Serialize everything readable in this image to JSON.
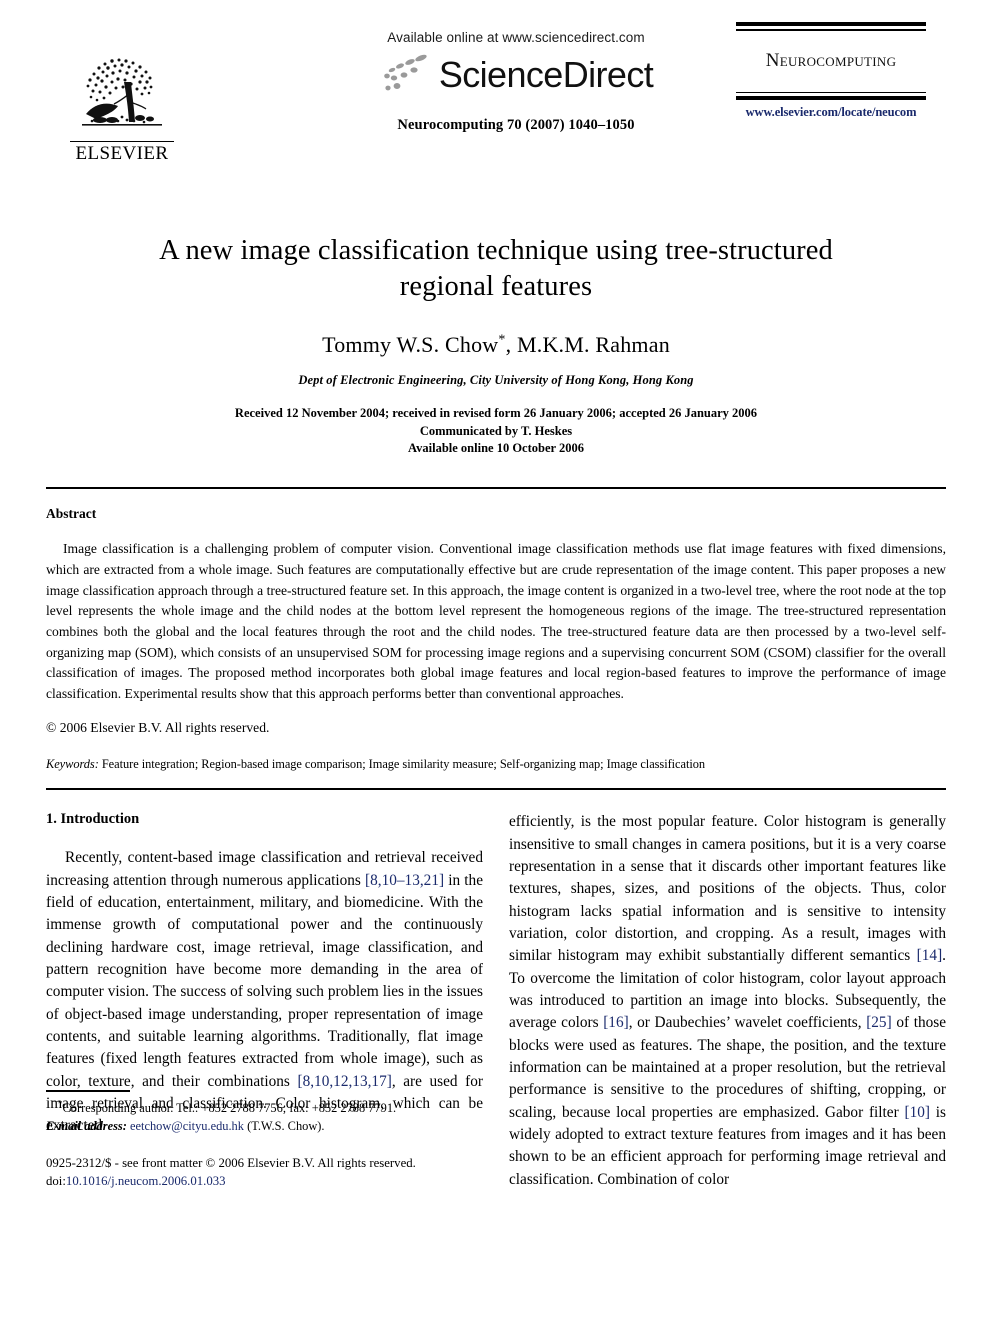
{
  "masthead": {
    "available_online": "Available online at www.sciencedirect.com",
    "sciencedirect_wordmark": "ScienceDirect",
    "journal_reference": "Neurocomputing 70 (2007) 1040–1050",
    "publisher_name": "ELSEVIER",
    "journal_brand": "Neurocomputing",
    "journal_url": "www.elsevier.com/locate/neucom"
  },
  "title_block": {
    "title": "A new image classification technique using tree-structured regional features",
    "authors_prefix": "Tommy W.S. Chow",
    "authors_marker": "*",
    "authors_suffix": ", M.K.M. Rahman",
    "affiliation": "Dept of Electronic Engineering, City University of Hong Kong, Hong Kong",
    "history_line1": "Received 12 November 2004; received in revised form 26 January 2006; accepted 26 January 2006",
    "history_line2": "Communicated by T. Heskes",
    "history_line3": "Available online 10 October 2006"
  },
  "abstract": {
    "heading": "Abstract",
    "body": "Image classification is a challenging problem of computer vision. Conventional image classification methods use flat image features with fixed dimensions, which are extracted from a whole image. Such features are computationally effective but are crude representation of the image content. This paper proposes a new image classification approach through a tree-structured feature set. In this approach, the image content is organized in a two-level tree, where the root node at the top level represents the whole image and the child nodes at the bottom level represent the homogeneous regions of the image. The tree-structured representation combines both the global and the local features through the root and the child nodes. The tree-structured feature data are then processed by a two-level self-organizing map (SOM), which consists of an unsupervised SOM for processing image regions and a supervising concurrent SOM (CSOM) classifier for the overall classification of images. The proposed method incorporates both global image features and local region-based features to improve the performance of image classification. Experimental results show that this approach performs better than conventional approaches.",
    "copyright": "© 2006 Elsevier B.V. All rights reserved.",
    "keywords_label": "Keywords:",
    "keywords_values": "Feature integration; Region-based image comparison; Image similarity measure; Self-organizing map; Image classification"
  },
  "introduction": {
    "heading": "1. Introduction",
    "left_paragraph_parts": [
      {
        "type": "text",
        "value": "Recently, content-based image classification and retrieval received increasing attention through numerous applications "
      },
      {
        "type": "cite",
        "value": "[8,10–13,21]"
      },
      {
        "type": "text",
        "value": " in the field of education, entertainment, military, and biomedicine. With the immense growth of computational power and the continuously declining hardware cost, image retrieval, image classification, and pattern recognition have become more demanding in the area of computer vision. The success of solving such problem lies in the issues of object-based image understanding, proper representation of image contents, and suitable learning algorithms. Traditionally, flat image features (fixed length features extracted from whole image), such as color, texture, and their combinations "
      },
      {
        "type": "cite",
        "value": "[8,10,12,13,17]"
      },
      {
        "type": "text",
        "value": ", are used for image retrieval and classification. Color histogram, which can be extracted"
      }
    ],
    "right_paragraph_parts": [
      {
        "type": "text",
        "value": "efficiently, is the most popular feature. Color histogram is generally insensitive to small changes in camera positions, but it is a very coarse representation in a sense that it discards other important features like textures, shapes, sizes, and positions of the objects. Thus, color histogram lacks spatial information and is sensitive to intensity variation, color distortion, and cropping. As a result, images with similar histogram may exhibit substantially different semantics "
      },
      {
        "type": "cite",
        "value": "[14]"
      },
      {
        "type": "text",
        "value": ". To overcome the limitation of color histogram, color layout approach was introduced to partition an image into blocks. Subsequently, the average colors "
      },
      {
        "type": "cite",
        "value": "[16]"
      },
      {
        "type": "text",
        "value": ", or Daubechies’ wavelet coefficients, "
      },
      {
        "type": "cite",
        "value": "[25]"
      },
      {
        "type": "text",
        "value": " of those blocks were used as features. The shape, the position, and the texture information can be maintained at a proper resolution, but the retrieval performance is sensitive to the procedures of shifting, cropping, or scaling, because local properties are emphasized. Gabor filter "
      },
      {
        "type": "cite",
        "value": "[10]"
      },
      {
        "type": "text",
        "value": " is widely adopted to extract texture features from images and it has been shown to be an efficient approach for performing image retrieval and classification. Combination of color"
      }
    ]
  },
  "footnote": {
    "marker": "*",
    "corresponding": "Corresponding author. Tel.: +852 2788 7756; fax: +852 2788 7791.",
    "email_label": "E-mail address:",
    "email_address": "eetchow@cityu.edu.hk",
    "email_owner": "(T.W.S. Chow).",
    "issn_line": "0925-2312/$ - see front matter © 2006 Elsevier B.V. All rights reserved.",
    "doi_label": "doi:",
    "doi_value": "10.1016/j.neucom.2006.01.033"
  },
  "colors": {
    "link_blue": "#1a2a6c",
    "text_black": "#000000",
    "logo_gray": "#8a8a8a"
  }
}
